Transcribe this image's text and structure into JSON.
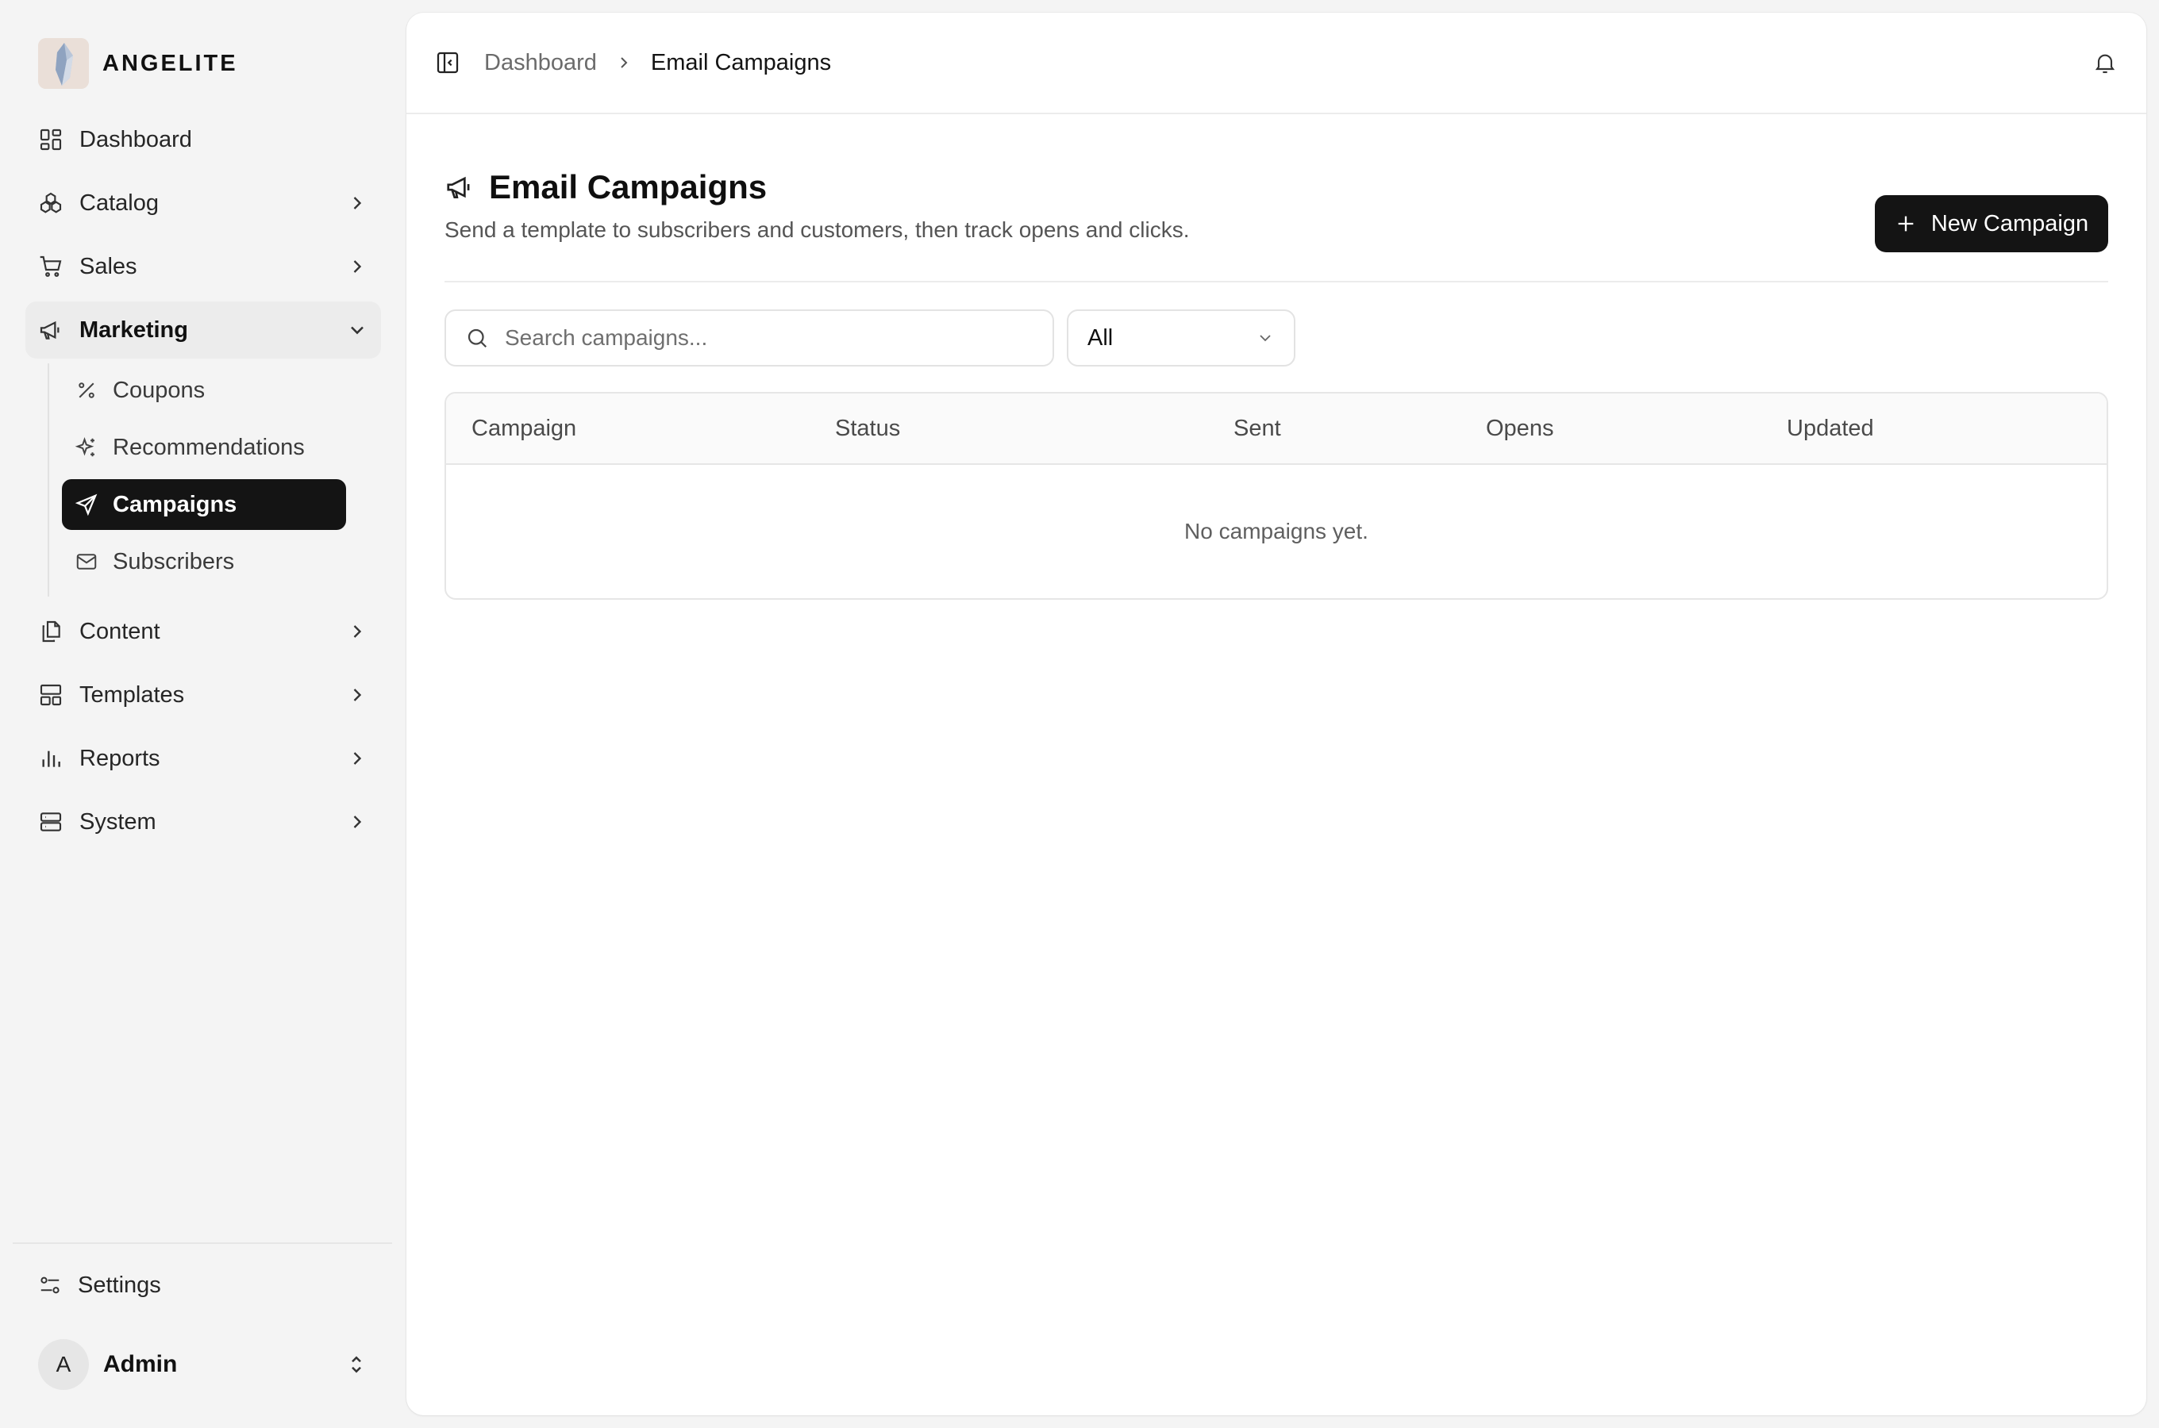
{
  "brand": {
    "name": "ANGELITE"
  },
  "sidebar": {
    "items": [
      {
        "label": "Dashboard",
        "icon": "dashboard-icon"
      },
      {
        "label": "Catalog",
        "icon": "catalog-icon"
      },
      {
        "label": "Sales",
        "icon": "cart-icon"
      },
      {
        "label": "Marketing",
        "icon": "megaphone-icon",
        "expanded": true,
        "children": [
          {
            "label": "Coupons",
            "icon": "percent-icon"
          },
          {
            "label": "Recommendations",
            "icon": "sparkles-icon"
          },
          {
            "label": "Campaigns",
            "icon": "send-icon",
            "active": true
          },
          {
            "label": "Subscribers",
            "icon": "mail-icon"
          }
        ]
      },
      {
        "label": "Content",
        "icon": "files-icon"
      },
      {
        "label": "Templates",
        "icon": "layout-icon"
      },
      {
        "label": "Reports",
        "icon": "bar-chart-icon"
      },
      {
        "label": "System",
        "icon": "server-icon"
      }
    ],
    "settings": {
      "label": "Settings",
      "icon": "settings-sliders-icon"
    },
    "user": {
      "initial": "A",
      "name": "Admin"
    }
  },
  "breadcrumb": {
    "parent": "Dashboard",
    "current": "Email Campaigns"
  },
  "page": {
    "title": "Email Campaigns",
    "subtitle": "Send a template to subscribers and customers, then track opens and clicks.",
    "new_button": "New Campaign"
  },
  "filters": {
    "search_placeholder": "Search campaigns...",
    "status_selected": "All"
  },
  "table": {
    "columns": [
      "Campaign",
      "Status",
      "Sent",
      "Opens",
      "Updated"
    ],
    "rows": [],
    "empty_text": "No campaigns yet."
  },
  "colors": {
    "accent": "#141414",
    "sidebar_bg": "#f4f4f4",
    "panel_bg": "#ffffff",
    "border": "#e6e6e6"
  }
}
